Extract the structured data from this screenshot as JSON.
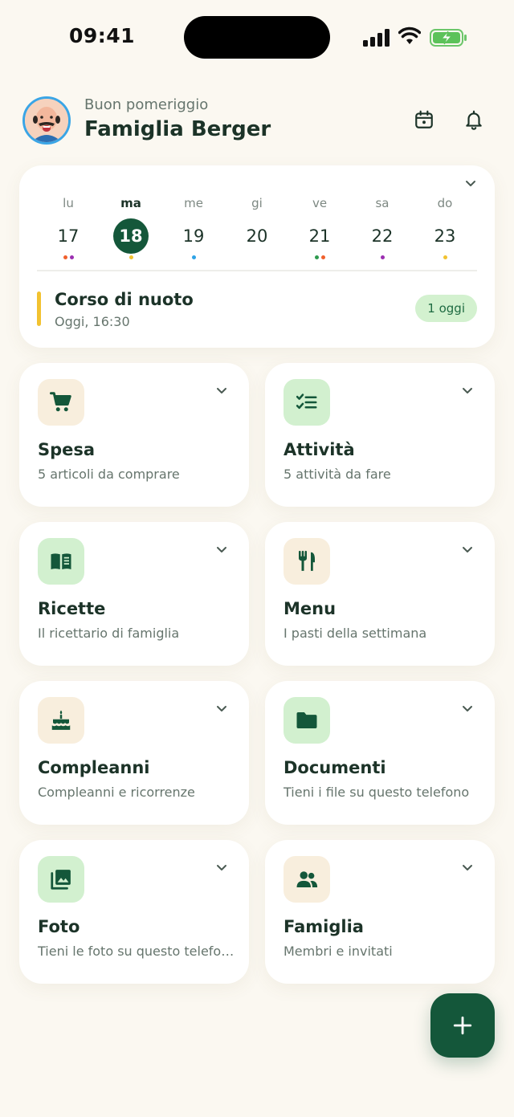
{
  "status_bar": {
    "time": "09:41"
  },
  "header": {
    "greeting": "Buon pomeriggio",
    "title": "Famiglia Berger"
  },
  "calendar": {
    "days": [
      {
        "weekday": "lu",
        "date": "17",
        "dots": [
          "#f0602c",
          "#9b2fb1"
        ]
      },
      {
        "weekday": "ma",
        "date": "18",
        "selected": true,
        "dots": [
          "#f2c230"
        ]
      },
      {
        "weekday": "me",
        "date": "19",
        "dots": [
          "#2ea3e6"
        ]
      },
      {
        "weekday": "gi",
        "date": "20",
        "dots": []
      },
      {
        "weekday": "ve",
        "date": "21",
        "dots": [
          "#2e9a4f",
          "#f0602c"
        ]
      },
      {
        "weekday": "sa",
        "date": "22",
        "dots": [
          "#9b2fb1"
        ]
      },
      {
        "weekday": "do",
        "date": "23",
        "dots": [
          "#f2c230"
        ]
      }
    ],
    "event": {
      "title": "Corso di nuoto",
      "time": "Oggi, 16:30",
      "color": "#f2c230"
    },
    "today_badge": "1 oggi"
  },
  "tiles": [
    {
      "title": "Spesa",
      "subtitle": "5 articoli da comprare",
      "icon": "cart-icon",
      "tint": "beige"
    },
    {
      "title": "Attività",
      "subtitle": "5 attività da fare",
      "icon": "checklist-icon",
      "tint": "green"
    },
    {
      "title": "Ricette",
      "subtitle": "Il ricettario di famiglia",
      "icon": "book-icon",
      "tint": "green"
    },
    {
      "title": "Menu",
      "subtitle": "I pasti della settimana",
      "icon": "cutlery-icon",
      "tint": "beige"
    },
    {
      "title": "Compleanni",
      "subtitle": "Compleanni e ricorrenze",
      "icon": "cake-icon",
      "tint": "beige"
    },
    {
      "title": "Documenti",
      "subtitle": "Tieni i file su questo telefono",
      "icon": "folder-icon",
      "tint": "green"
    },
    {
      "title": "Foto",
      "subtitle": "Tieni le foto su questo telefono",
      "icon": "photo-icon",
      "tint": "green"
    },
    {
      "title": "Famiglia",
      "subtitle": "Membri e invitati",
      "icon": "people-icon",
      "tint": "beige"
    }
  ],
  "colors": {
    "accent": "#14573a",
    "background": "#fbf8f1"
  }
}
